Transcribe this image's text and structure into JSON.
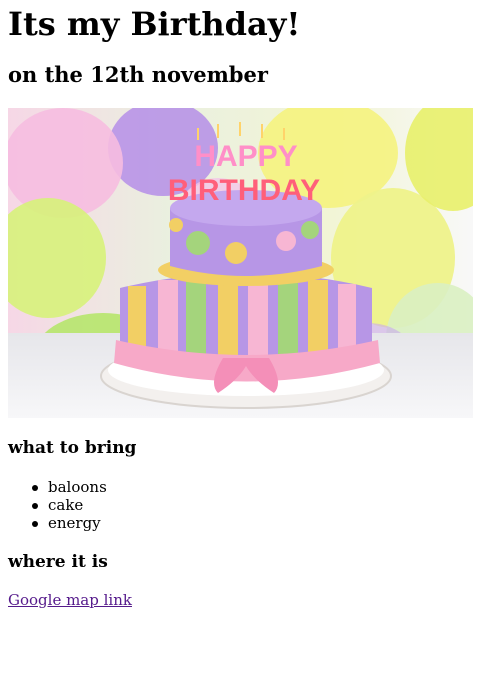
{
  "page": {
    "title": "Its my Birthday!",
    "subtitle": "on the 12th november",
    "section_bring": {
      "heading": "what to bring",
      "items": [
        "baloons",
        "cake",
        "energy"
      ]
    },
    "section_where": {
      "heading": "where it is",
      "link_text": "Google map link"
    },
    "image": {
      "alt_text": "",
      "cake_topper_text": "HAPPY BIRTHDAY"
    },
    "colors": {
      "link": "#551a8b",
      "text": "#000000",
      "background": "#ffffff"
    }
  }
}
